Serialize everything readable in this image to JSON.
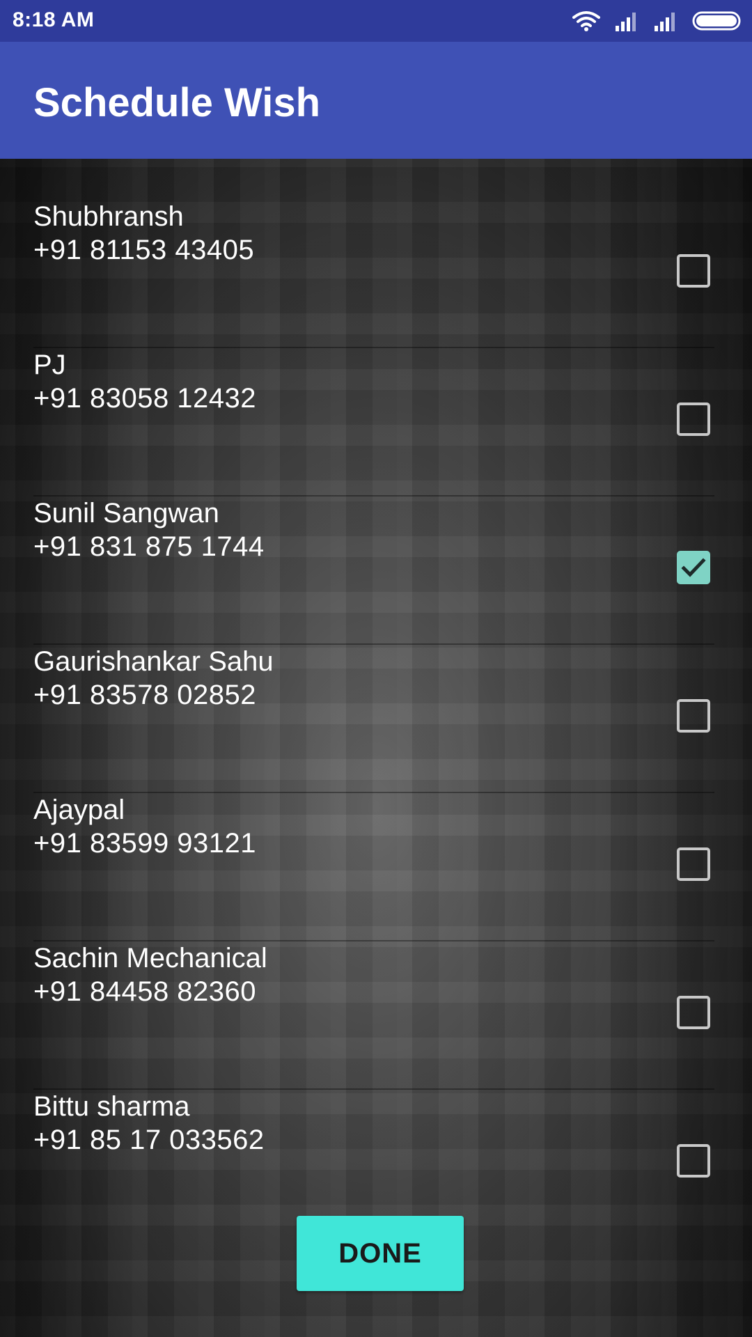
{
  "status_bar": {
    "time": "8:18 AM",
    "icons": [
      "wifi-icon",
      "signal-icon",
      "signal-icon",
      "battery-icon"
    ]
  },
  "app_bar": {
    "title": "Schedule Wish"
  },
  "contacts": [
    {
      "name": "Shubhransh",
      "phone": "+91 81153 43405",
      "checked": false
    },
    {
      "name": "PJ",
      "phone": "+91 83058 12432",
      "checked": false
    },
    {
      "name": "Sunil Sangwan",
      "phone": "+91 831 875 1744",
      "checked": true
    },
    {
      "name": "Gaurishankar Sahu",
      "phone": "+91 83578 02852",
      "checked": false
    },
    {
      "name": "Ajaypal",
      "phone": "+91 83599 93121",
      "checked": false
    },
    {
      "name": "Sachin Mechanical",
      "phone": "+91 84458 82360",
      "checked": false
    },
    {
      "name": "Bittu sharma",
      "phone": "+91 85 17 033562",
      "checked": false
    }
  ],
  "done_button": {
    "label": "DONE"
  },
  "colors": {
    "status_bar": "#2f3b9b",
    "app_bar": "#3f51b5",
    "accent": "#40e6d8",
    "checkbox_checked": "#7fd3c5"
  }
}
